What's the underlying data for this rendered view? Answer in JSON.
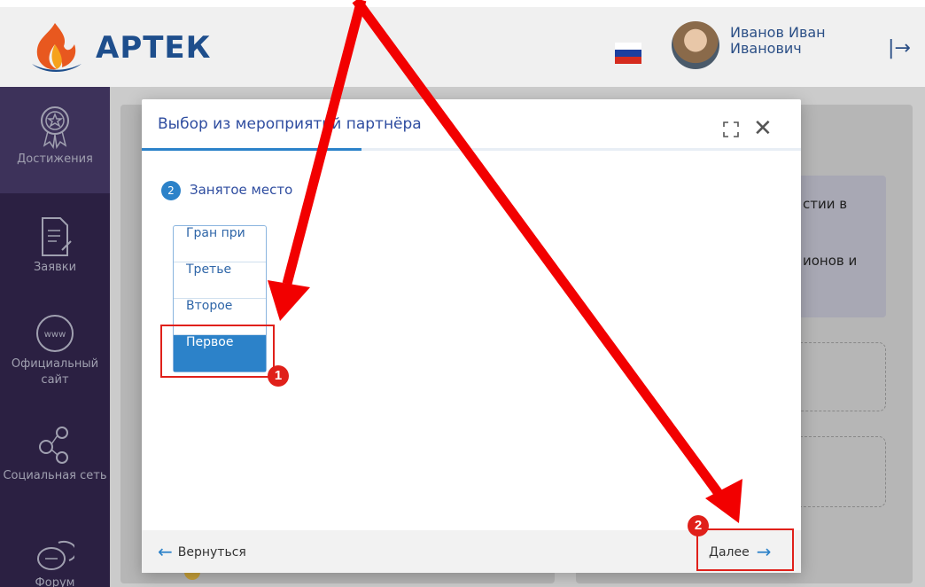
{
  "header": {
    "logo_text": "АРТЕК",
    "user_name_line1": "Иванов Иван",
    "user_name_line2": "Иванович",
    "logout_icon": "logout-icon"
  },
  "sidebar": {
    "items": [
      {
        "label": "Достижения",
        "icon": "medal-icon"
      },
      {
        "label": "Заявки",
        "icon": "document-icon"
      },
      {
        "label": "Официальный сайт",
        "icon": "www-icon"
      },
      {
        "label": "Социальная сеть",
        "icon": "social-network-icon"
      },
      {
        "label": "Форум",
        "icon": "chat-icon"
      }
    ]
  },
  "background": {
    "text_line1": "стии в",
    "text_line2": ".",
    "text_line3": "ионов и"
  },
  "modal": {
    "title": "Выбор из мероприятий партнёра",
    "step_number": "2",
    "step_label": "Занятое место",
    "options": [
      "Гран при",
      "Третье",
      "Второе",
      "Первое"
    ],
    "selected_option": "Первое",
    "back_label": "Вернуться",
    "next_label": "Далее"
  },
  "annotations": {
    "badge1": "1",
    "badge2": "2",
    "color": "#e0201a"
  },
  "colors": {
    "sidebar": "#2b2042",
    "accent": "#2c82c9",
    "title": "#2f4da0"
  }
}
